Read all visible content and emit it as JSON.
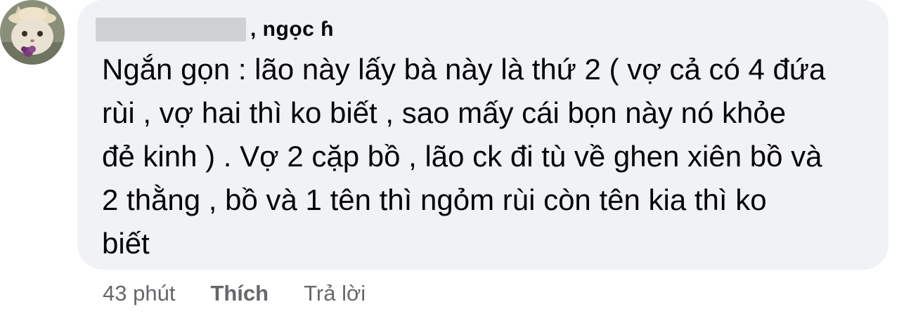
{
  "comment": {
    "author_name": ", ngọc ɦ",
    "text": "Ngắn gọn : lão này lấy bà này là thứ 2 ( vợ cả có 4 đứa\nrùi , vợ hai thì ko biết , sao mấy cái bọn này nó khỏe\nđẻ kinh ) . Vợ 2 cặp bồ , lão ck đi tù về ghen xiên bồ và\n2 thằng , bồ và 1 tên thì ngỏm rùi còn tên kia thì ko\nbiết",
    "avatar_icon": "cat-avatar-icon"
  },
  "actions": {
    "time": "43 phút",
    "like_label": "Thích",
    "reply_label": "Trả lời"
  },
  "colors": {
    "bubble_bg": "#f0f2f5",
    "text": "#050505",
    "meta": "#65676b"
  }
}
